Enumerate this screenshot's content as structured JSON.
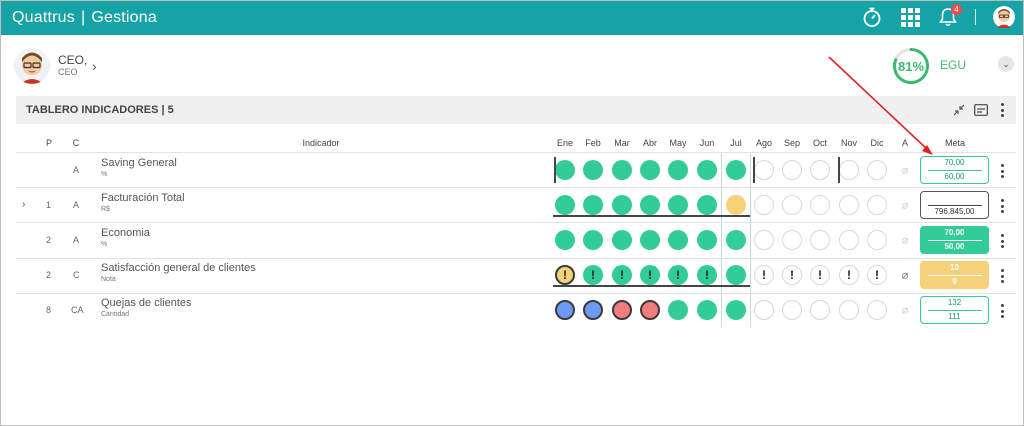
{
  "app": {
    "name": "Quattrus",
    "separator": "|",
    "module": "Gestiona"
  },
  "topbar": {
    "notifications_count": "4",
    "icons": [
      "stopwatch-icon",
      "apps-grid-icon",
      "bell-icon",
      "user-avatar"
    ]
  },
  "user": {
    "name": "CEO,",
    "role": "CEO"
  },
  "score": {
    "value": "81%",
    "percent": 81,
    "label": "EGU",
    "color": "#3cba6b"
  },
  "panel": {
    "title": "TABLERO INDICADORES | 5"
  },
  "columns": {
    "p": "P",
    "c": "C",
    "indicator": "Indicador",
    "months": [
      "Ene",
      "Feb",
      "Mar",
      "Abr",
      "May",
      "Jun",
      "Jul",
      "Ago",
      "Sep",
      "Oct",
      "Nov",
      "Dic"
    ],
    "a": "A",
    "meta": "Meta"
  },
  "rows": [
    {
      "p": "",
      "c": "A",
      "name": "Saving General",
      "unit": "%",
      "meta_top": "70,00",
      "meta_bottom": "60,00",
      "statuses": [
        "green",
        "green",
        "green",
        "green",
        "green",
        "green",
        "green",
        "empty",
        "empty",
        "empty",
        "empty",
        "empty"
      ]
    },
    {
      "p": "1",
      "c": "A",
      "name": "Facturación Total",
      "unit": "R$",
      "meta_top": "",
      "meta_bottom": "796.845,00",
      "statuses": [
        "green",
        "green",
        "green",
        "green",
        "green",
        "green",
        "yellow",
        "empty",
        "empty",
        "empty",
        "empty",
        "empty"
      ]
    },
    {
      "p": "2",
      "c": "A",
      "name": "Economia",
      "unit": "%",
      "meta_top": "70,00",
      "meta_bottom": "50,00",
      "statuses": [
        "green",
        "green",
        "green",
        "green",
        "green",
        "green",
        "green",
        "empty",
        "empty",
        "empty",
        "empty",
        "empty"
      ]
    },
    {
      "p": "2",
      "c": "C",
      "name": "Satisfacción general de clientes",
      "unit": "Nota",
      "meta_top": "10",
      "meta_bottom": "9",
      "statuses": [
        "yellow",
        "green",
        "green",
        "green",
        "green",
        "green",
        "green",
        "empty",
        "empty",
        "empty",
        "empty",
        "empty"
      ],
      "mark": "!"
    },
    {
      "p": "8",
      "c": "CA",
      "name": "Quejas de clientes",
      "unit": "Cantidad",
      "meta_top": "132",
      "meta_bottom": "111",
      "statuses": [
        "blue",
        "blue",
        "red",
        "red",
        "green",
        "green",
        "green",
        "empty",
        "empty",
        "empty",
        "empty",
        "empty"
      ]
    }
  ],
  "colors": {
    "topbar": "#15a3a6",
    "green": "#33cc99",
    "yellow": "#f4d17a",
    "red": "#f47c7c",
    "blue": "#6b9bf5"
  }
}
